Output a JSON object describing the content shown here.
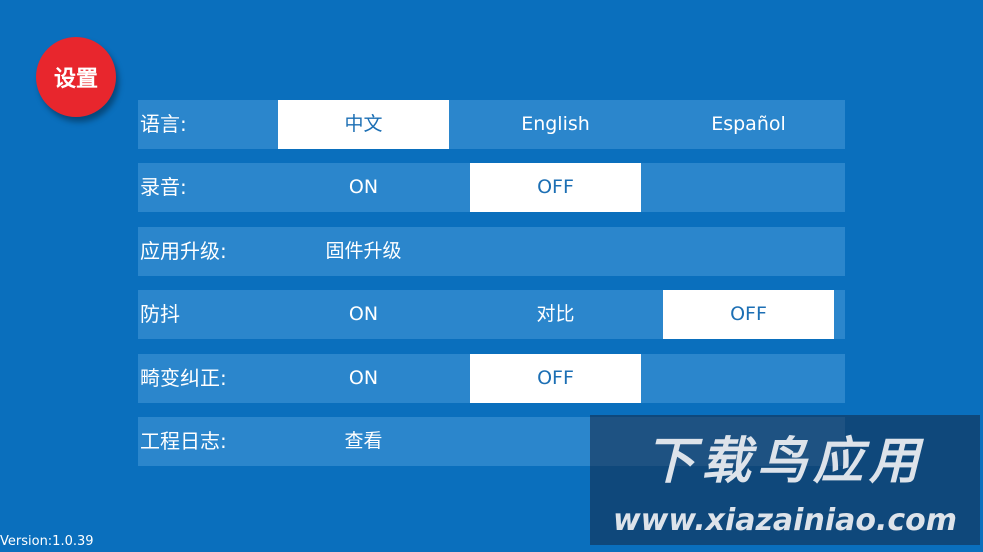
{
  "header": {
    "title": "设置"
  },
  "rows": [
    {
      "label": "语言:",
      "options": [
        "中文",
        "English",
        "Español"
      ],
      "selected": 0
    },
    {
      "label": "录音:",
      "options": [
        "ON",
        "OFF"
      ],
      "selected": 1
    },
    {
      "label": "应用升级:",
      "options": [
        "固件升级"
      ],
      "selected": null
    },
    {
      "label": "防抖",
      "options": [
        "ON",
        "对比",
        "OFF"
      ],
      "selected": 2
    },
    {
      "label": "畸变纠正:",
      "options": [
        "ON",
        "OFF"
      ],
      "selected": 1
    },
    {
      "label": "工程日志:",
      "options": [
        "查看"
      ],
      "selected": null
    }
  ],
  "footer": {
    "version": "Version:1.0.39"
  },
  "watermark": {
    "title": "下载鸟应用",
    "url": "www.xiazainiao.com"
  },
  "colors": {
    "background": "#0a6fbd",
    "row": "#2b86cc",
    "selected_bg": "#ffffff",
    "selected_text": "#1c6fb4",
    "badge": "#e8262d"
  }
}
